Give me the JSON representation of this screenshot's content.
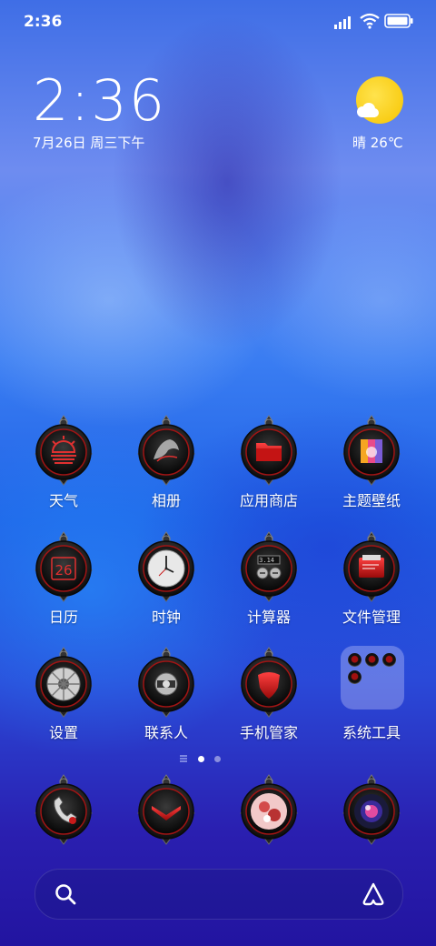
{
  "status_bar": {
    "time": "2:36",
    "signal_icon": "signal-icon",
    "wifi_icon": "wifi-icon",
    "battery_icon": "battery-icon"
  },
  "clock_widget": {
    "time": "2:36",
    "date": "7月26日 周三下午"
  },
  "weather_widget": {
    "icon": "sun-cloud-icon",
    "text": "晴 26℃"
  },
  "apps": [
    {
      "label": "天气",
      "icon": "weather-icon"
    },
    {
      "label": "相册",
      "icon": "gallery-icon"
    },
    {
      "label": "应用商店",
      "icon": "app-store-icon"
    },
    {
      "label": "主题壁纸",
      "icon": "themes-icon"
    },
    {
      "label": "日历",
      "icon": "calendar-icon",
      "icon_text": "26"
    },
    {
      "label": "时钟",
      "icon": "clock-icon"
    },
    {
      "label": "计算器",
      "icon": "calculator-icon",
      "icon_text": "3.14"
    },
    {
      "label": "文件管理",
      "icon": "file-manager-icon"
    },
    {
      "label": "设置",
      "icon": "settings-icon"
    },
    {
      "label": "联系人",
      "icon": "contacts-icon"
    },
    {
      "label": "手机管家",
      "icon": "security-icon"
    },
    {
      "label": "系统工具",
      "icon": "system-tools-folder-icon"
    }
  ],
  "page_indicator": {
    "pages": 2,
    "current": 1
  },
  "dock": [
    {
      "icon": "phone-icon"
    },
    {
      "icon": "messages-icon"
    },
    {
      "icon": "browser-icon"
    },
    {
      "icon": "camera-icon"
    }
  ],
  "search_bar": {
    "search_icon": "search-icon",
    "assistant_icon": "assistant-icon"
  },
  "colors": {
    "icon_ring": "#1a1a1a",
    "icon_accent": "#c81a1a",
    "sun": "#f6c400"
  }
}
